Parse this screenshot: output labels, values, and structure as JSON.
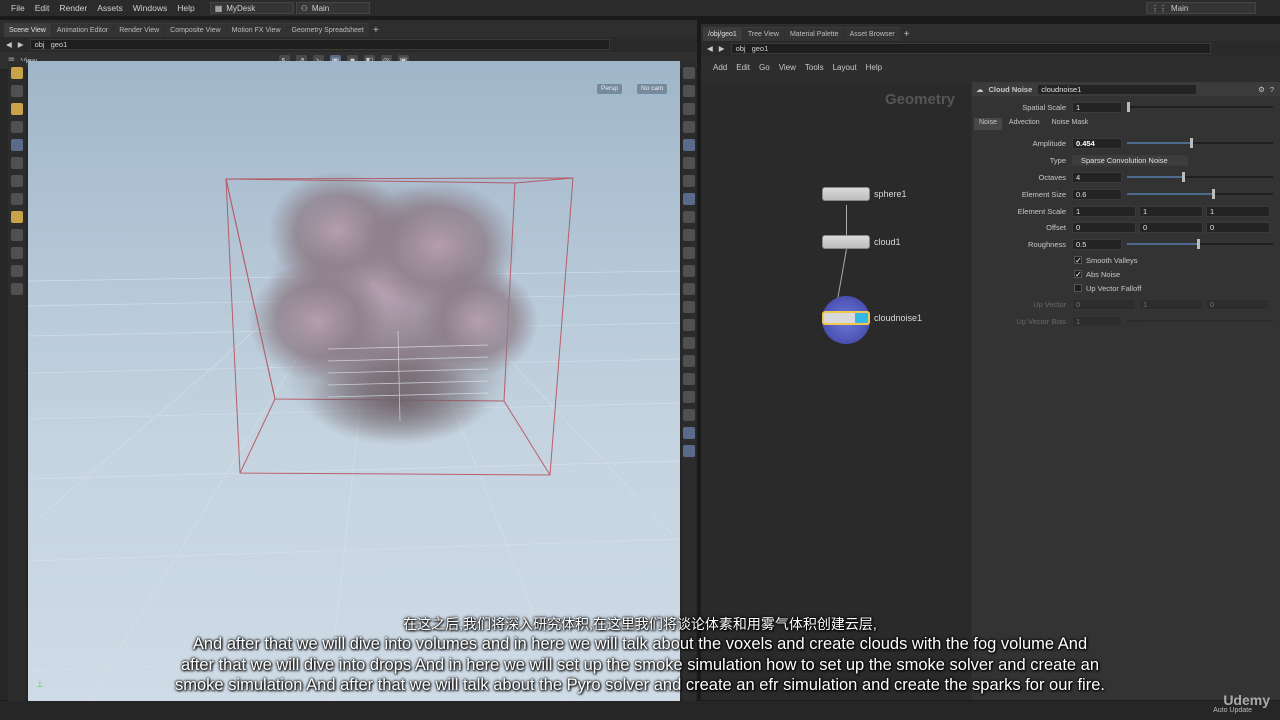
{
  "menubar": {
    "items": [
      "File",
      "Edit",
      "Render",
      "Assets",
      "Windows",
      "Help"
    ],
    "desktop": "MyDesk",
    "main": "Main",
    "right_main": "Main"
  },
  "left_pane": {
    "tabs": [
      "Scene View",
      "Animation Editor",
      "Render View",
      "Composite View",
      "Motion FX View",
      "Geometry Spreadsheet"
    ],
    "path": [
      "obj",
      "geo1"
    ],
    "view_label": "View",
    "persp_btn": "Persp",
    "cam_btn": "No cam"
  },
  "right_pane": {
    "tabs": [
      "/obj/geo1",
      "Tree View",
      "Material Palette",
      "Asset Browser"
    ],
    "path": [
      "obj",
      "geo1"
    ],
    "menu": [
      "Add",
      "Edit",
      "Go",
      "View",
      "Tools",
      "Layout",
      "Help"
    ],
    "network_title": "Geometry",
    "nodes": [
      "sphere1",
      "cloud1",
      "cloudnoise1"
    ]
  },
  "params": {
    "node_type": "Cloud Noise",
    "node_name": "cloudnoise1",
    "spatial_scale_label": "Spatial Scale",
    "spatial_scale": "1",
    "tabs": [
      "Noise",
      "Advection",
      "Noise Mask"
    ],
    "amplitude_label": "Amplitude",
    "amplitude": "0.454",
    "type_label": "Type",
    "type_value": "Sparse Convolution Noise",
    "octaves_label": "Octaves",
    "octaves": "4",
    "element_size_label": "Element Size",
    "element_size": "0.6",
    "element_scale_label": "Element Scale",
    "element_scale": [
      "1",
      "1",
      "1"
    ],
    "offset_label": "Offset",
    "offset": [
      "0",
      "0",
      "0"
    ],
    "roughness_label": "Roughness",
    "roughness": "0.5",
    "smooth_valleys": "Smooth Valleys",
    "abs_noise": "Abs Noise",
    "up_vector_falloff": "Up Vector Falloff",
    "up_vector_label": "Up Vector",
    "up_vector": [
      "0",
      "1",
      "0"
    ],
    "up_vector_bias_label": "Up Vector Bias",
    "up_vector_bias": "1",
    "slider_fraction": {
      "amplitude": 0.454,
      "octaves": 0.4,
      "element_size": 0.6,
      "roughness": 0.5
    }
  },
  "subtitles": {
    "zh": "在这之后,我们将深入研究体积,在这里我们将谈论体素和用雾气体积创建云层,",
    "en1": "And after that  we will dive into volumes and in here we will talk about the voxels and create clouds with the fog volume  And",
    "en2": "after that we will dive into drops  And in here we will set up the smoke simulation  how to set up the smoke solver and create an",
    "en3": "smoke simulation  And after that we will talk about the Pyro solver and create an efr simulation and create the sparks for our fire."
  },
  "watermark": "Udemy",
  "auto_update": "Auto Update"
}
